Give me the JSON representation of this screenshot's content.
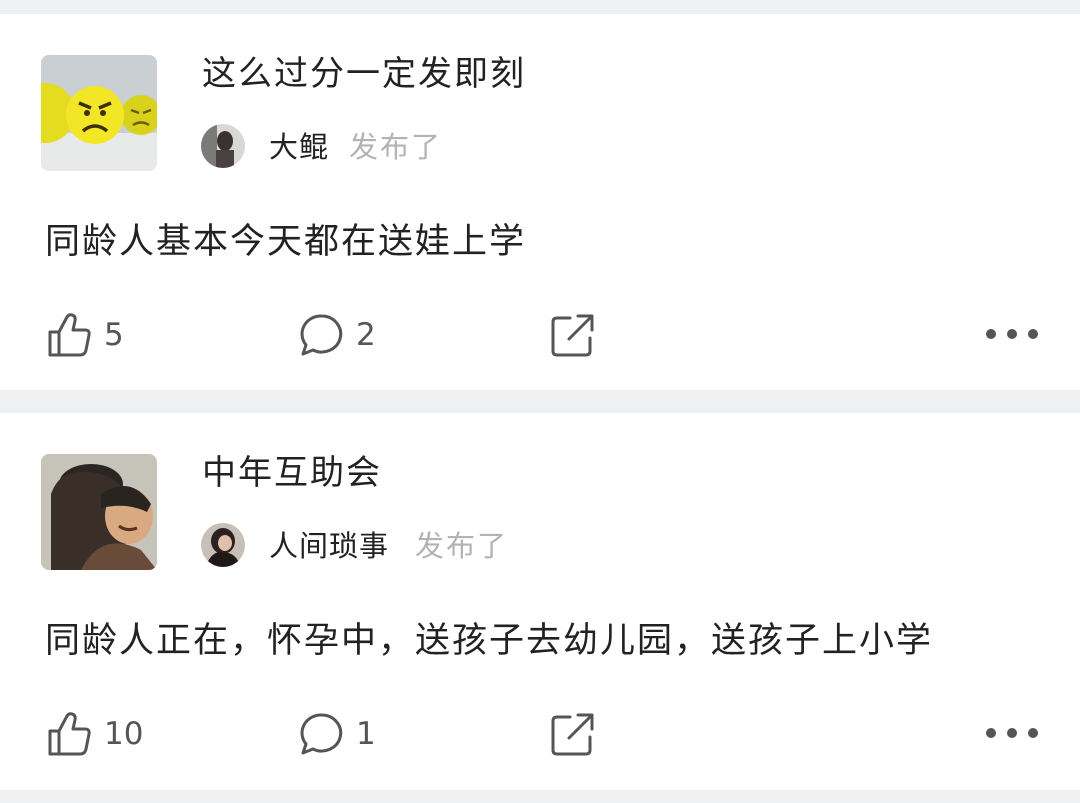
{
  "posts": [
    {
      "group_name": "这么过分一定发即刻",
      "user_name": "大鲲",
      "action_text": "发布了",
      "content": "同龄人基本今天都在送娃上学",
      "like_count": "5",
      "comment_count": "2"
    },
    {
      "group_name": "中年互助会",
      "user_name": "人间琐事",
      "action_text": "发布了",
      "content": "同龄人正在，怀孕中，送孩子去幼儿园，送孩子上小学",
      "like_count": "10",
      "comment_count": "1"
    }
  ],
  "icons": {
    "like": "thumbs-up-icon",
    "comment": "comment-bubble-icon",
    "share": "share-icon",
    "more": "more-dots-icon"
  }
}
